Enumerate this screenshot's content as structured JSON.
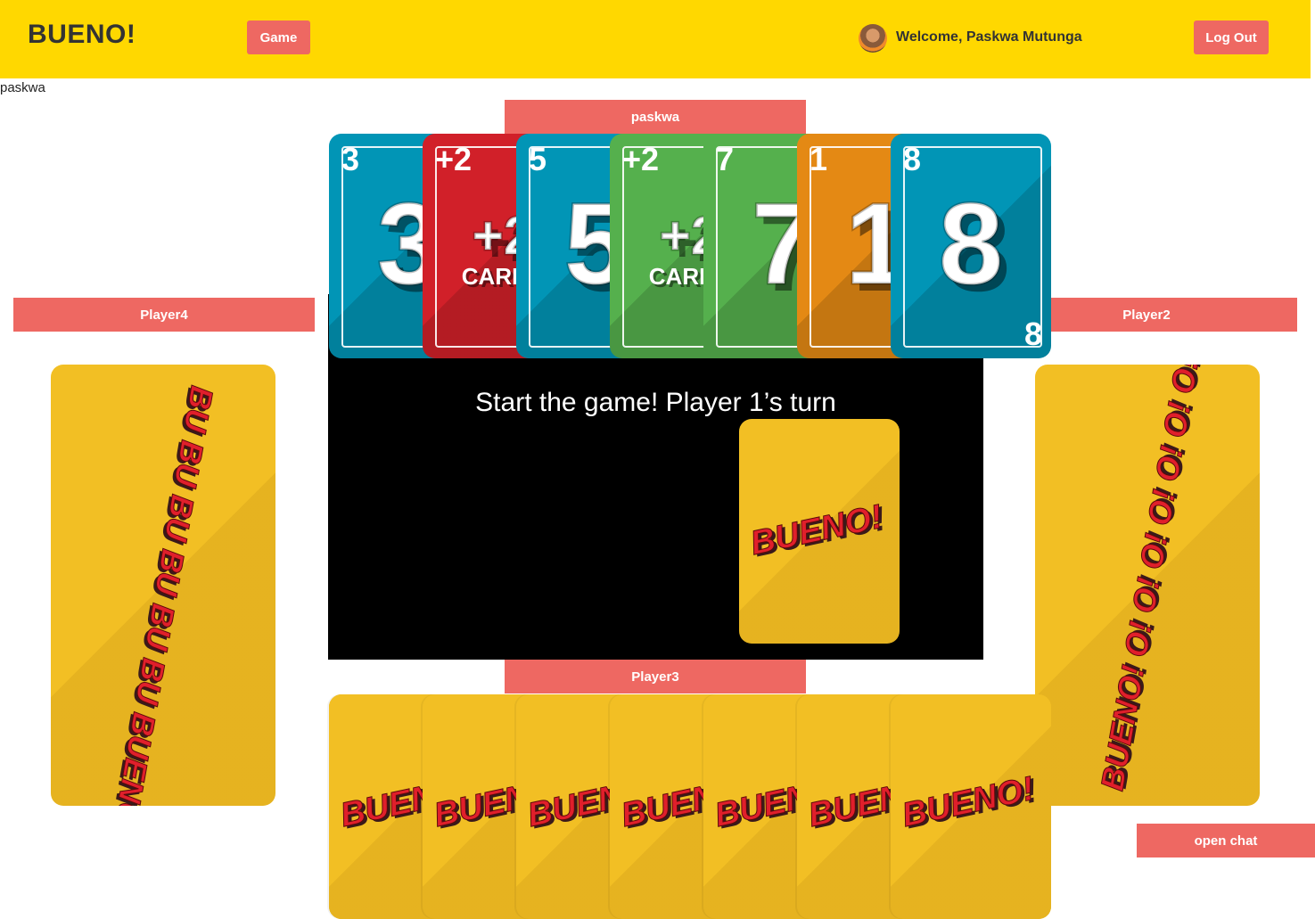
{
  "header": {
    "brand": "BUENO!",
    "nav_game": "Game",
    "welcome": "Welcome, Paskwa Mutunga",
    "logout": "Log Out"
  },
  "username": "paskwa",
  "players": {
    "top": "paskwa",
    "left": "Player4",
    "right": "Player2",
    "bottom": "Player3"
  },
  "status": "Start the game! Player 1’s turn",
  "deck_logo": "BUENO!",
  "hand": [
    {
      "value": "3",
      "color": "#0195b6",
      "sub": ""
    },
    {
      "value": "+2",
      "color": "#d12029",
      "sub": "CARDS"
    },
    {
      "value": "5",
      "color": "#0195b6",
      "sub": ""
    },
    {
      "value": "+2",
      "color": "#55b04d",
      "sub": "CARDS"
    },
    {
      "value": "7",
      "color": "#55b04d",
      "sub": ""
    },
    {
      "value": "1",
      "color": "#e48914",
      "sub": ""
    },
    {
      "value": "8",
      "color": "#0195b6",
      "sub": ""
    }
  ],
  "left_stack_text": "BU BU BU BU BU BU BUENO!",
  "right_stack_text": "BUENO! O! O! O! O! O! O! O!",
  "bottom_stack_text": "BUENO!",
  "chat": "open chat"
}
